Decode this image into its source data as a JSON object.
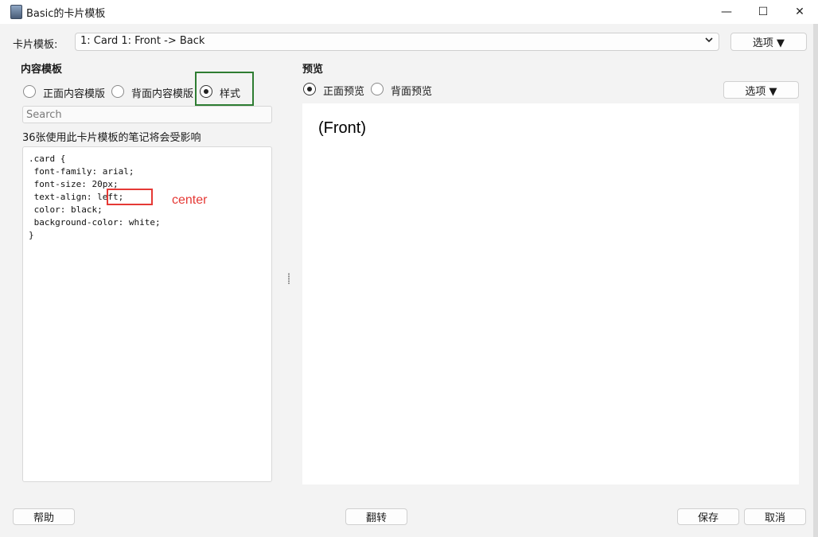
{
  "window": {
    "title": "Basic的卡片模板",
    "minimize_glyph": "—",
    "maximize_glyph": "☐",
    "close_glyph": "✕"
  },
  "toolbar": {
    "template_label": "卡片模板:",
    "template_value": "1: Card 1: Front -> Back",
    "options_button": "选项 ▼"
  },
  "content": {
    "heading": "内容模板",
    "radios": [
      {
        "label": "正面内容模版",
        "selected": false
      },
      {
        "label": "背面内容模版",
        "selected": false
      },
      {
        "label": "样式",
        "selected": true
      }
    ],
    "search_placeholder": "Search",
    "usage_note": "36张使用此卡片模板的笔记将会受影响",
    "code_lines": [
      ".card {",
      " font-family: arial;",
      " font-size: 20px;",
      " text-align: left;",
      " color: black;",
      " background-color: white;",
      "}"
    ],
    "annotation": "center"
  },
  "preview": {
    "heading": "预览",
    "radios": [
      {
        "label": "正面预览",
        "selected": true
      },
      {
        "label": "背面预览",
        "selected": false
      }
    ],
    "options_button": "选项 ▼",
    "front_text": "(Front)"
  },
  "footer": {
    "help": "帮助",
    "flip": "翻转",
    "save": "保存",
    "cancel": "取消"
  },
  "colors": {
    "annotation_green": "#2e7d32",
    "annotation_red": "#e53935"
  }
}
